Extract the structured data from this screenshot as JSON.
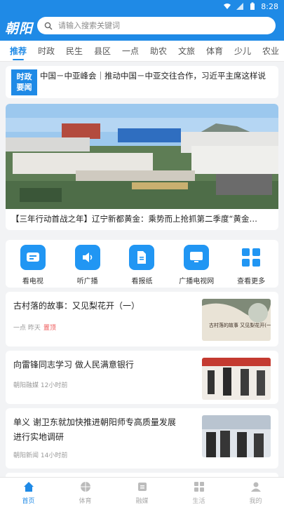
{
  "status_bar": {
    "time": "8:28"
  },
  "header": {
    "logo": "朝阳",
    "search_placeholder": "请输入搜索关键词"
  },
  "tabs": [
    "推荐",
    "时政",
    "民生",
    "县区",
    "一点",
    "助农",
    "文旅",
    "体育",
    "少儿",
    "农业"
  ],
  "breaking": {
    "badge_line1": "时政",
    "badge_line2": "要闻",
    "text": "中国－中亚峰会｜推动中国－中亚交往合作，习近平主席这样说"
  },
  "banner": {
    "caption": "【三年行动首战之年】辽宁新都黄金：乘势而上抢抓第二季度“黄金…"
  },
  "quick_links": [
    {
      "label": "看电视",
      "icon": "tv-icon"
    },
    {
      "label": "听广播",
      "icon": "speaker-icon"
    },
    {
      "label": "看报纸",
      "icon": "newspaper-icon"
    },
    {
      "label": "广播电视网",
      "icon": "monitor-icon"
    },
    {
      "label": "查看更多",
      "icon": "grid-icon"
    }
  ],
  "news": [
    {
      "title": "古村落的故事：又见梨花开（一）",
      "source": "一点 昨天",
      "tag": "置顶",
      "thumb_text": "古村落的故事 又见梨花开(一)"
    },
    {
      "title": "向雷锋同志学习 做人民满意银行",
      "source": "朝阳融媒 12小时前",
      "tag": ""
    },
    {
      "title": "单义 谢卫东就加快推进朝阳师专高质量发展进行实地调研",
      "source": "朝阳新闻 14小时前",
      "tag": ""
    }
  ],
  "bottom_nav": [
    {
      "label": "首页",
      "icon": "home-icon",
      "active": true
    },
    {
      "label": "体育",
      "icon": "ball-icon"
    },
    {
      "label": "融媒",
      "icon": "media-icon"
    },
    {
      "label": "生活",
      "icon": "life-icon"
    },
    {
      "label": "我的",
      "icon": "user-icon"
    }
  ],
  "colors": {
    "brand": "#1f8ae6",
    "tag_red": "#e55555"
  }
}
